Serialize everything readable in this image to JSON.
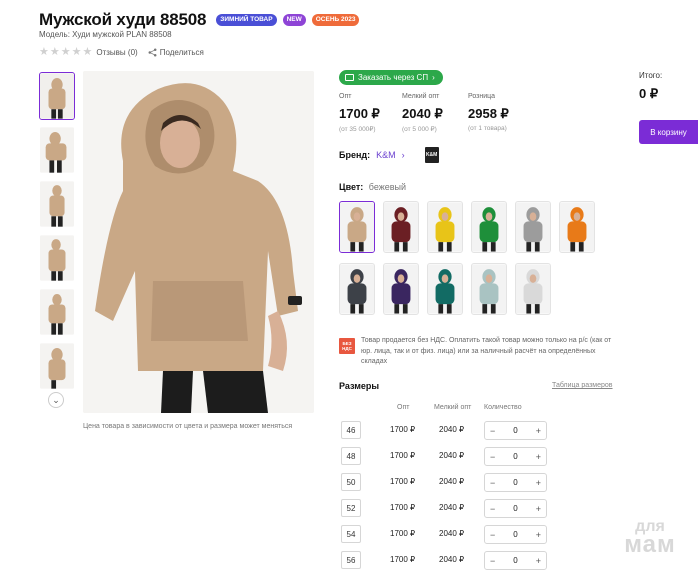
{
  "product": {
    "title": "Мужской худи 88508",
    "badges": [
      {
        "label": "ЗИМНИЙ ТОВАР",
        "color": "#4a4fd6"
      },
      {
        "label": "NEW",
        "color": "#8e44d6"
      },
      {
        "label": "ОСЕНЬ 2023",
        "color": "#ef6b3a"
      }
    ],
    "model": "Модель: Худи мужской PLAN 88508",
    "reviews": "Отзывы (0)",
    "share": "Поделиться",
    "photo_note": "Цена товара в зависимости от цвета и размера может меняться"
  },
  "order_button": "Заказать через СП",
  "prices": [
    {
      "label": "Опт",
      "value": "1700 ₽",
      "sub": "(от 35 000₽)"
    },
    {
      "label": "Мелкий опт",
      "value": "2040 ₽",
      "sub": "(от 5 000 ₽)"
    },
    {
      "label": "Розница",
      "value": "2958 ₽",
      "sub": "(от 1 товара)"
    }
  ],
  "brand": {
    "label": "Бренд:",
    "value": "K&M",
    "logo_text": "K&M"
  },
  "color": {
    "label": "Цвет:",
    "value": "бежевый"
  },
  "swatch_colors": [
    "#c9a886",
    "#6b1f24",
    "#e8c418",
    "#1e8f3a",
    "#9c9c9c",
    "#e87a18",
    "#3d4148",
    "#3a2660",
    "#126b64",
    "#a9c3c2",
    "#d9d9d9"
  ],
  "tax_notice": {
    "badge_line1": "БЕЗ",
    "badge_line2": "НДС",
    "text": "Товар продается без НДС. Оплатить такой товар можно только на р/с  (как от юр. лица, так и от физ. лица) или за наличный расчёт на определённых складах"
  },
  "sizes": {
    "title": "Размеры",
    "table_link": "Таблица размеров",
    "headers": {
      "opt": "Опт",
      "small_opt": "Мелкий опт",
      "qty": "Количество"
    },
    "rows": [
      {
        "size": "46",
        "opt": "1700 ₽",
        "small_opt": "2040 ₽",
        "qty": "0"
      },
      {
        "size": "48",
        "opt": "1700 ₽",
        "small_opt": "2040 ₽",
        "qty": "0"
      },
      {
        "size": "50",
        "opt": "1700 ₽",
        "small_opt": "2040 ₽",
        "qty": "0"
      },
      {
        "size": "52",
        "opt": "1700 ₽",
        "small_opt": "2040 ₽",
        "qty": "0"
      },
      {
        "size": "54",
        "opt": "1700 ₽",
        "small_opt": "2040 ₽",
        "qty": "0"
      },
      {
        "size": "56",
        "opt": "1700 ₽",
        "small_opt": "2040 ₽",
        "qty": "0"
      }
    ]
  },
  "total": {
    "label": "Итого:",
    "value": "0 ₽"
  },
  "cart_button": "В корзину",
  "watermark": {
    "line1": "для",
    "line2": "мам"
  },
  "icons": {
    "star": "star-icon",
    "share": "share-icon",
    "chevron": "chevron-down-icon",
    "cart": "cart-icon",
    "minus": "minus-icon",
    "plus": "plus-icon"
  }
}
